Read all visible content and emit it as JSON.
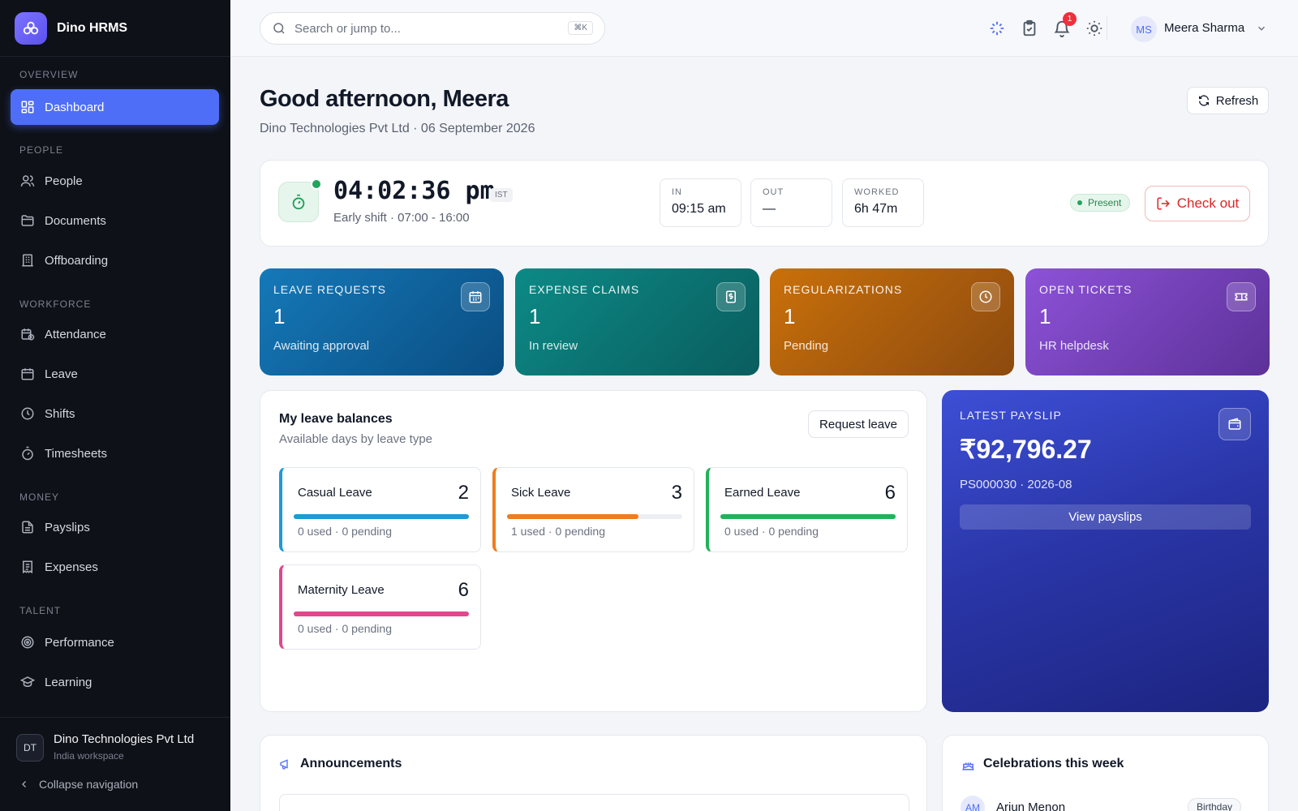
{
  "app": {
    "name": "Dino HRMS"
  },
  "sidebar": {
    "sections": {
      "overview": "OVERVIEW",
      "people": "PEOPLE",
      "workforce": "WORKFORCE",
      "money": "MONEY",
      "talent": "TALENT"
    },
    "items": [
      {
        "label": "Dashboard",
        "icon": "dashboard-icon",
        "active": true
      },
      {
        "label": "People",
        "icon": "users-icon"
      },
      {
        "label": "Documents",
        "icon": "folder-icon"
      },
      {
        "label": "Offboarding",
        "icon": "building-icon"
      },
      {
        "label": "Attendance",
        "icon": "calendar-clock-icon"
      },
      {
        "label": "Leave",
        "icon": "calendar-icon"
      },
      {
        "label": "Shifts",
        "icon": "clock-icon"
      },
      {
        "label": "Timesheets",
        "icon": "timer-icon"
      },
      {
        "label": "Payslips",
        "icon": "file-text-icon"
      },
      {
        "label": "Expenses",
        "icon": "receipt-icon"
      },
      {
        "label": "Performance",
        "icon": "target-icon"
      },
      {
        "label": "Learning",
        "icon": "graduation-cap-icon"
      }
    ],
    "footer": {
      "org_initials": "DT",
      "org_name": "Dino Technologies Pvt Ltd",
      "org_sub": "India workspace",
      "collapse_label": "Collapse navigation"
    }
  },
  "topbar": {
    "search_placeholder": "Search or jump to...",
    "search_shortcut": "⌘K",
    "notification_count": "1",
    "user_initials": "MS",
    "user_name": "Meera Sharma",
    "icons": [
      "sparkles-icon",
      "clipboard-icon",
      "bell-icon",
      "sun-icon"
    ]
  },
  "header": {
    "greeting": "Good afternoon, Meera",
    "subline": "Dino Technologies Pvt Ltd · 06 September 2026",
    "refresh_label": "Refresh"
  },
  "clock": {
    "time": "04:02:36 pm",
    "timezone": "IST",
    "shift": "Early shift · 07:00 - 16:00",
    "stats": [
      {
        "label": "IN",
        "value": "09:15 am"
      },
      {
        "label": "OUT",
        "value": "—"
      },
      {
        "label": "WORKED",
        "value": "6h 47m"
      }
    ],
    "status": "Present",
    "checkout_label": "Check out"
  },
  "tiles": [
    {
      "title": "LEAVE REQUESTS",
      "count": "1",
      "sub": "Awaiting approval",
      "icon": "calendar-icon"
    },
    {
      "title": "EXPENSE CLAIMS",
      "count": "1",
      "sub": "In review",
      "icon": "receipt-icon"
    },
    {
      "title": "REGULARIZATIONS",
      "count": "1",
      "sub": "Pending",
      "icon": "clock-icon"
    },
    {
      "title": "OPEN TICKETS",
      "count": "1",
      "sub": "HR helpdesk",
      "icon": "ticket-icon"
    }
  ],
  "leave_balances": {
    "title": "My leave balances",
    "subtitle": "Available days by leave type",
    "request_label": "Request leave",
    "items": [
      {
        "name": "Casual Leave",
        "available": "2",
        "meta": "0 used · 0 pending",
        "fill": 1.0,
        "color": "#1e9ad6"
      },
      {
        "name": "Sick Leave",
        "available": "3",
        "meta": "1 used · 0 pending",
        "fill": 0.75,
        "color": "#f07c1e"
      },
      {
        "name": "Earned Leave",
        "available": "6",
        "meta": "0 used · 0 pending",
        "fill": 1.0,
        "color": "#22b35a"
      },
      {
        "name": "Maternity Leave",
        "available": "6",
        "meta": "0 used · 0 pending",
        "fill": 1.0,
        "color": "#e0478c"
      }
    ]
  },
  "payslip": {
    "label": "LATEST PAYSLIP",
    "amount": "₹92,796.27",
    "ref": "PS000030 · 2026-08",
    "button": "View payslips",
    "icon": "wallet-icon"
  },
  "announcements": {
    "title": "Announcements",
    "icon": "megaphone-icon"
  },
  "celebrations": {
    "title": "Celebrations this week",
    "icon": "cake-icon",
    "items": [
      {
        "initials": "AM",
        "name": "Arjun Menon",
        "tag": "Birthday"
      }
    ]
  }
}
